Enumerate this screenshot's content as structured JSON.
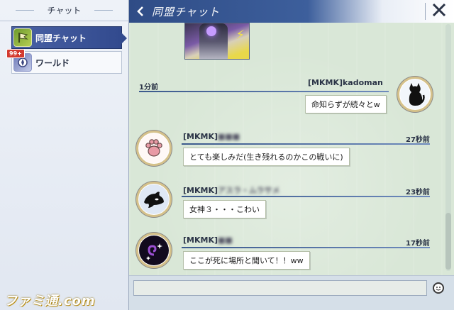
{
  "sidebar": {
    "title": "チャット",
    "channels": [
      {
        "label": "同盟チャット",
        "active": true,
        "icon": "alliance-flag-icon"
      },
      {
        "label": "ワールド",
        "active": false,
        "icon": "world-emblem-icon",
        "badge": "99+"
      }
    ]
  },
  "header": {
    "title": "同盟チャット",
    "back_icon": "chevron-left-icon",
    "close_icon": "close-icon"
  },
  "messages": [
    {
      "side": "right",
      "name": "[MKMK]kadoman",
      "time": "1分前",
      "text": "命知らずが続々とw",
      "avatar_icon": "black-cat-icon"
    },
    {
      "side": "left",
      "name_prefix": "[MKMK]",
      "name_hidden": "■■■",
      "time": "27秒前",
      "text": "とても楽しみだ(生き残れるのかこの戦いに)",
      "avatar_icon": "paw-print-icon"
    },
    {
      "side": "left",
      "name_prefix": "[MKMK]",
      "name_hidden": "アスラ・ムラサメ",
      "time": "23秒前",
      "text": "女神３・・・こわい",
      "avatar_icon": "orca-icon"
    },
    {
      "side": "left",
      "name_prefix": "[MKMK]",
      "name_hidden": "■■",
      "time": "17秒前",
      "text": "ここが死に場所と聞いて！！ww",
      "avatar_icon": "dark-spiral-icon"
    }
  ],
  "input": {
    "value": "",
    "emoji_icon": "smiley-icon"
  },
  "watermark": "ファミ通.com"
}
